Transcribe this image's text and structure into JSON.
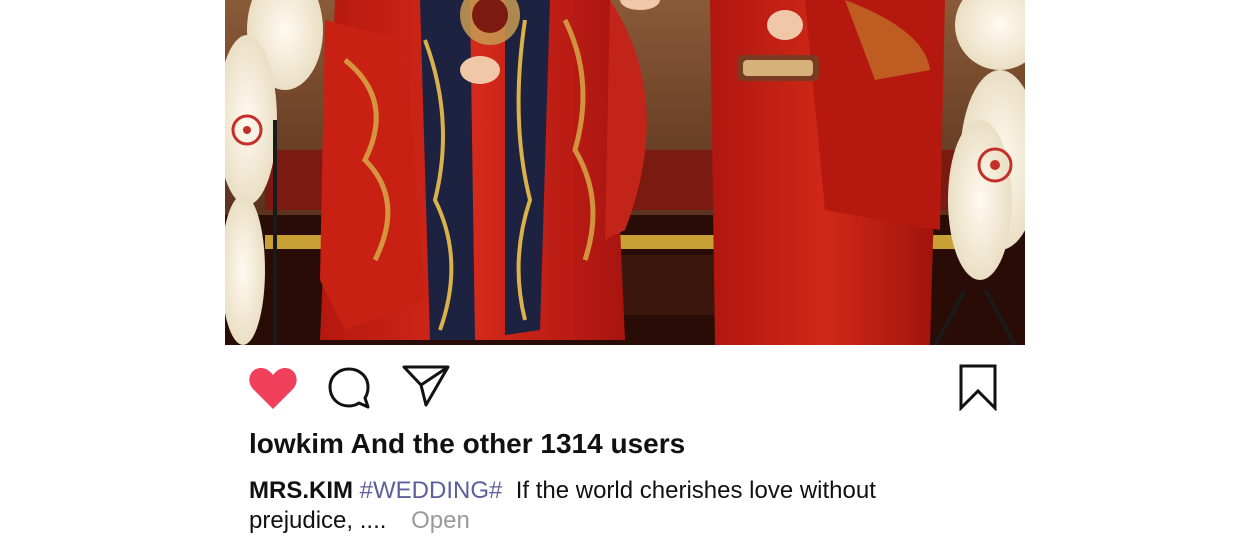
{
  "post": {
    "image_alt": "Couple in red embroidered traditional wedding robes beside paper lanterns",
    "actions": {
      "like_icon": "heart-icon",
      "comment_icon": "speech-bubble-icon",
      "share_icon": "paper-plane-icon",
      "save_icon": "bookmark-icon",
      "liked": true,
      "like_color": "#f0405c"
    },
    "likes": {
      "text": "lowkim And the other 1314 users"
    },
    "caption": {
      "author": "MRS.KIM",
      "hashtag": "#WEDDING#",
      "text": "If the world cherishes love without prejudice, ....",
      "more_label": "Open"
    }
  }
}
